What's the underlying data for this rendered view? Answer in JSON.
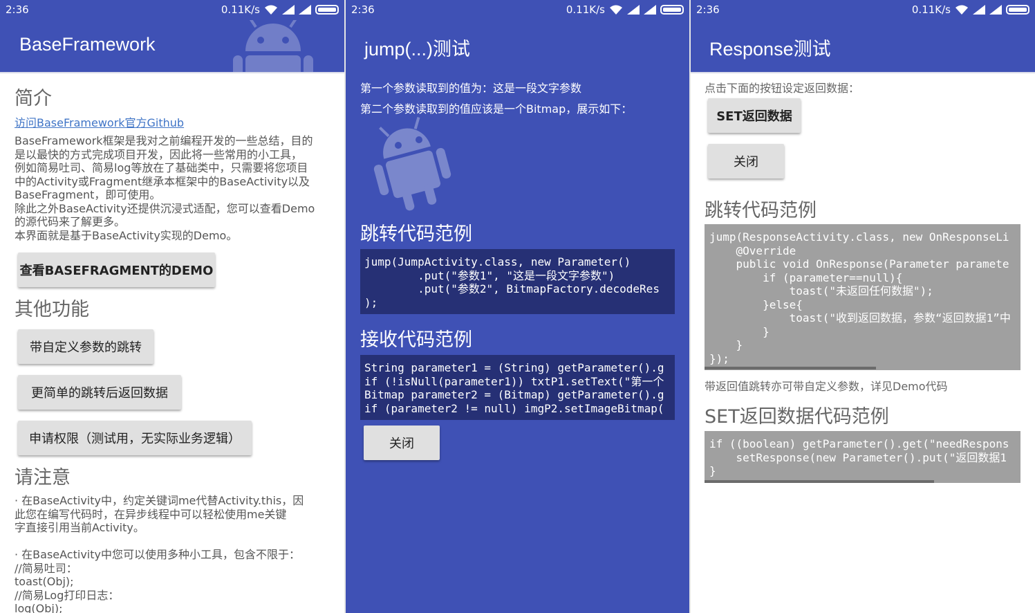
{
  "status": {
    "time": "2:36",
    "speed": "0.11K/s"
  },
  "screen1": {
    "title": "BaseFramework",
    "intro_heading": "简介",
    "github_link": "访问BaseFramework官方Github",
    "intro_paragraph": "BaseFramework框架是我对之前编程开发的一些总结，目的\n是以最快的方式完成项目开发，因此将一些常用的小工具，\n例如简易吐司、简易log等放在了基础类中，只需要将您项目\n中的Activity或Fragment继承本框架中的BaseActivity以及\nBaseFragment，即可使用。\n除此之外BaseActivity还提供沉浸式适配，您可以查看Demo\n的源代码来了解更多。\n本界面就是基于BaseActivity实现的Demo。",
    "demo_button": "查看BASEFRAGMENT的DEMO",
    "other_heading": "其他功能",
    "btn_jump_params": "带自定义参数的跳转",
    "btn_jump_return": "更简单的跳转后返回数据",
    "btn_permission": "申请权限（测试用，无实际业务逻辑）",
    "notice_heading": "请注意",
    "notice_text": "· 在BaseActivity中，约定关键词me代替Activity.this，因\n此您在编写代码时，在异步线程中可以轻松使用me关键\n字直接引用当前Activity。\n\n· 在BaseActivity中您可以使用多种小工具，包含不限于：\n//简易吐司：\ntoast(Obj);\n//简易Log打印日志：\nlog(Obj);"
  },
  "screen2": {
    "title": "jump(...)测试",
    "param1_text": "第一个参数读取到的值为：这是一段文字参数",
    "param2_text": "第二个参数读取到的值应该是一个Bitmap，展示如下：",
    "jump_heading": "跳转代码范例",
    "jump_code": "jump(JumpActivity.class, new Parameter()\n        .put(\"参数1\", \"这是一段文字参数\")\n        .put(\"参数2\", BitmapFactory.decodeRes\n);",
    "receive_heading": "接收代码范例",
    "receive_code": "String parameter1 = (String) getParameter().g\nif (!isNull(parameter1)) txtP1.setText(\"第一个\nBitmap parameter2 = (Bitmap) getParameter().g\nif (parameter2 != null) imgP2.setImageBitmap(",
    "close_button": "关闭"
  },
  "screen3": {
    "title": "Response测试",
    "hint_text": "点击下面的按钮设定返回数据：",
    "set_button": "SET返回数据",
    "close_button": "关闭",
    "jump_heading": "跳转代码范例",
    "jump_code": "jump(ResponseActivity.class, new OnResponseLi\n    @Override\n    public void OnResponse(Parameter paramete\n        if (parameter==null){\n            toast(\"未返回任何数据\");\n        }else{\n            toast(\"收到返回数据，参数“返回数据1”中\n        }\n    }\n});",
    "note_text": "带返回值跳转亦可带自定义参数，详见Demo代码",
    "set_heading": "SET返回数据代码范例",
    "set_code": "if ((boolean) getParameter().get(\"needRespons\n    setResponse(new Parameter().put(\"返回数据1\n}"
  },
  "icons": [
    "wifi-icon",
    "signal-icon",
    "battery-icon",
    "android-robot-icon"
  ],
  "colors": {
    "primary": "#3f51b5",
    "code_dark": "#263075",
    "code_grey": "#a0a0a0",
    "button": "#e0e0e0"
  }
}
